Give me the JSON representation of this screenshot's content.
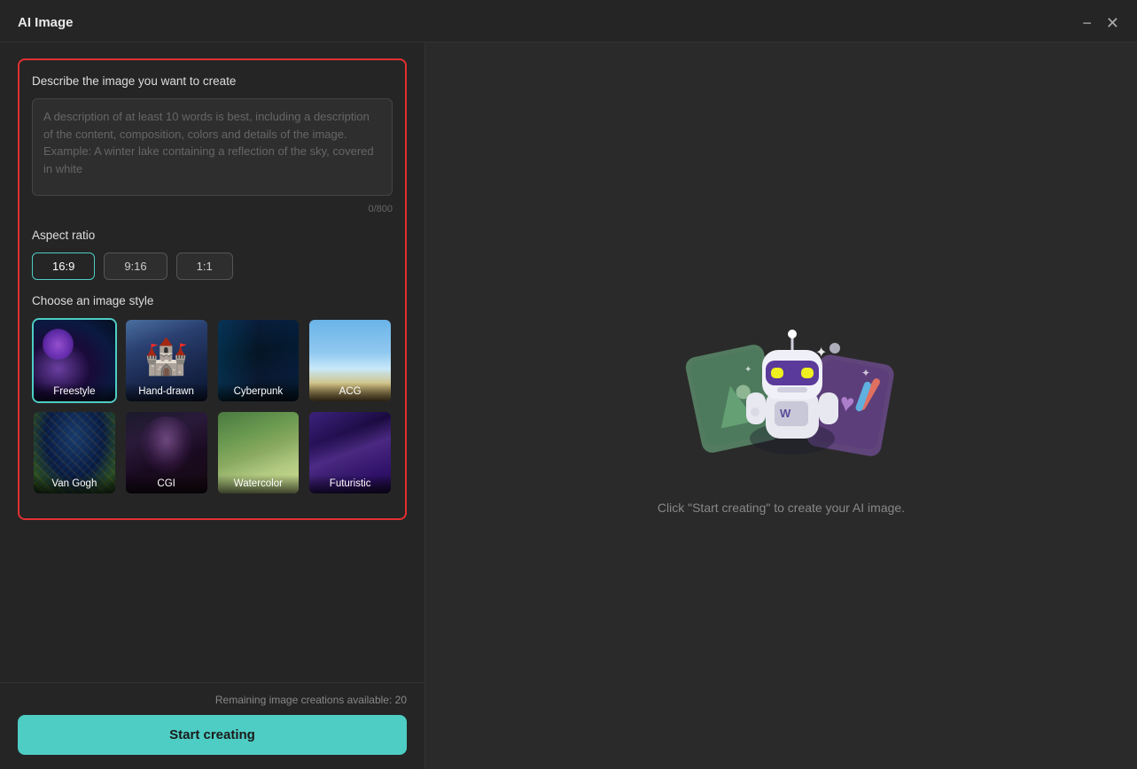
{
  "window": {
    "title": "AI Image",
    "minimize_label": "−",
    "close_label": "✕"
  },
  "left": {
    "describe_section": {
      "title": "Describe the image you want to create",
      "textarea_placeholder": "A description of at least 10 words is best, including a description of the content, composition, colors and details of the image. Example: A winter lake containing a reflection of the sky, covered in white",
      "textarea_value": "",
      "char_count": "0/800"
    },
    "aspect_ratio": {
      "title": "Aspect ratio",
      "options": [
        {
          "label": "16:9",
          "active": true
        },
        {
          "label": "9:16",
          "active": false
        },
        {
          "label": "1:1",
          "active": false
        }
      ]
    },
    "style_section": {
      "title": "Choose an image style",
      "styles": [
        {
          "id": "freestyle",
          "label": "Freestyle",
          "selected": true
        },
        {
          "id": "handdrawn",
          "label": "Hand-drawn",
          "selected": false
        },
        {
          "id": "cyberpunk",
          "label": "Cyberpunk",
          "selected": false
        },
        {
          "id": "acg",
          "label": "ACG",
          "selected": false
        },
        {
          "id": "vangogh",
          "label": "Van Gogh",
          "selected": false
        },
        {
          "id": "cgi",
          "label": "CGI",
          "selected": false
        },
        {
          "id": "watercolor",
          "label": "Watercolor",
          "selected": false
        },
        {
          "id": "futuristic",
          "label": "Futuristic",
          "selected": false
        }
      ]
    },
    "footer": {
      "remaining_text": "Remaining image creations available: 20",
      "start_button_label": "Start creating"
    }
  },
  "right": {
    "hint_text": "Click \"Start creating\" to create your AI image."
  }
}
